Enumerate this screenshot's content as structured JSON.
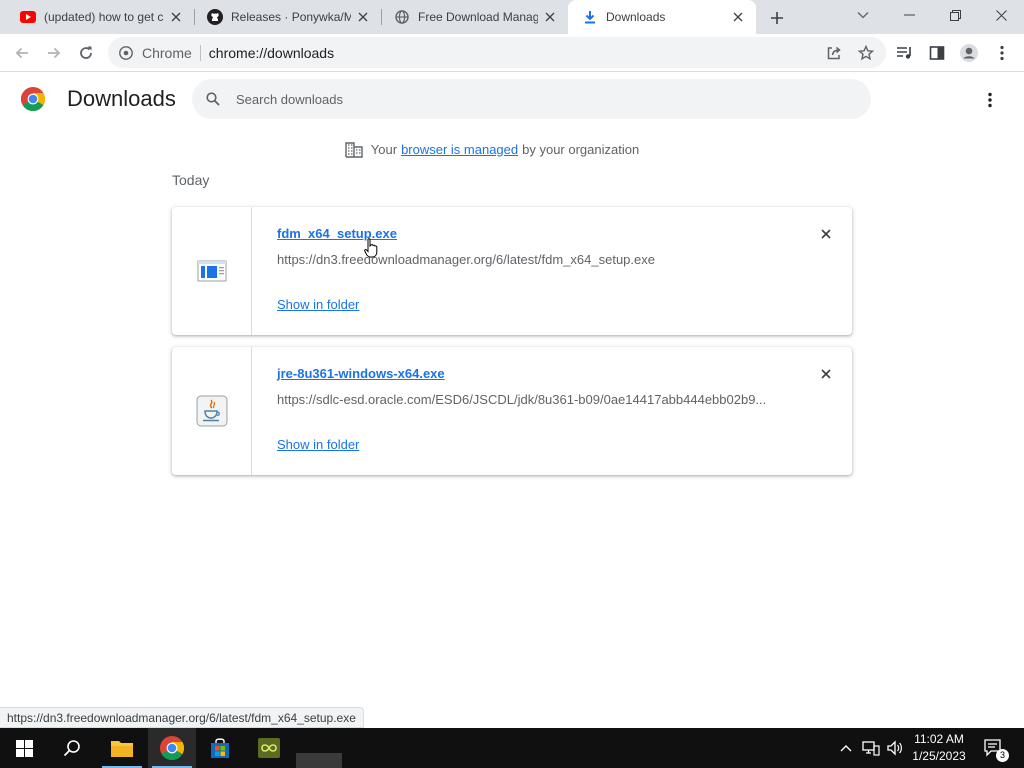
{
  "browser": {
    "tabs": [
      {
        "title": "(updated) how to get c",
        "icon": "youtube-icon",
        "active": false
      },
      {
        "title": "Releases · Ponywka/Mu",
        "icon": "github-icon",
        "active": false
      },
      {
        "title": "Free Download Manag",
        "icon": "globe-icon",
        "active": false
      },
      {
        "title": "Downloads",
        "icon": "download-icon",
        "active": true
      }
    ],
    "omnibox": {
      "chip": "Chrome",
      "url": "chrome://downloads"
    }
  },
  "page": {
    "title": "Downloads",
    "search_placeholder": "Search downloads",
    "managed": {
      "prefix": "Your",
      "link": "browser is managed",
      "suffix": "by your organization"
    },
    "section": "Today",
    "downloads": [
      {
        "name": "fdm_x64_setup.exe",
        "url": "https://dn3.freedownloadmanager.org/6/latest/fdm_x64_setup.exe",
        "action": "Show in folder",
        "icon": "installer-icon"
      },
      {
        "name": "jre-8u361-windows-x64.exe",
        "url": "https://sdlc-esd.oracle.com/ESD6/JSCDL/jdk/8u361-b09/0ae14417abb444ebb02b9...",
        "action": "Show in folder",
        "icon": "java-icon"
      }
    ],
    "status_url": "https://dn3.freedownloadmanager.org/6/latest/fdm_x64_setup.exe"
  },
  "taskbar": {
    "time": "11:02 AM",
    "date": "1/25/2023",
    "notification_count": "3"
  },
  "colors": {
    "accent": "#1a73e8",
    "tab_strip": "#dee1e6",
    "taskbar": "#101010"
  }
}
